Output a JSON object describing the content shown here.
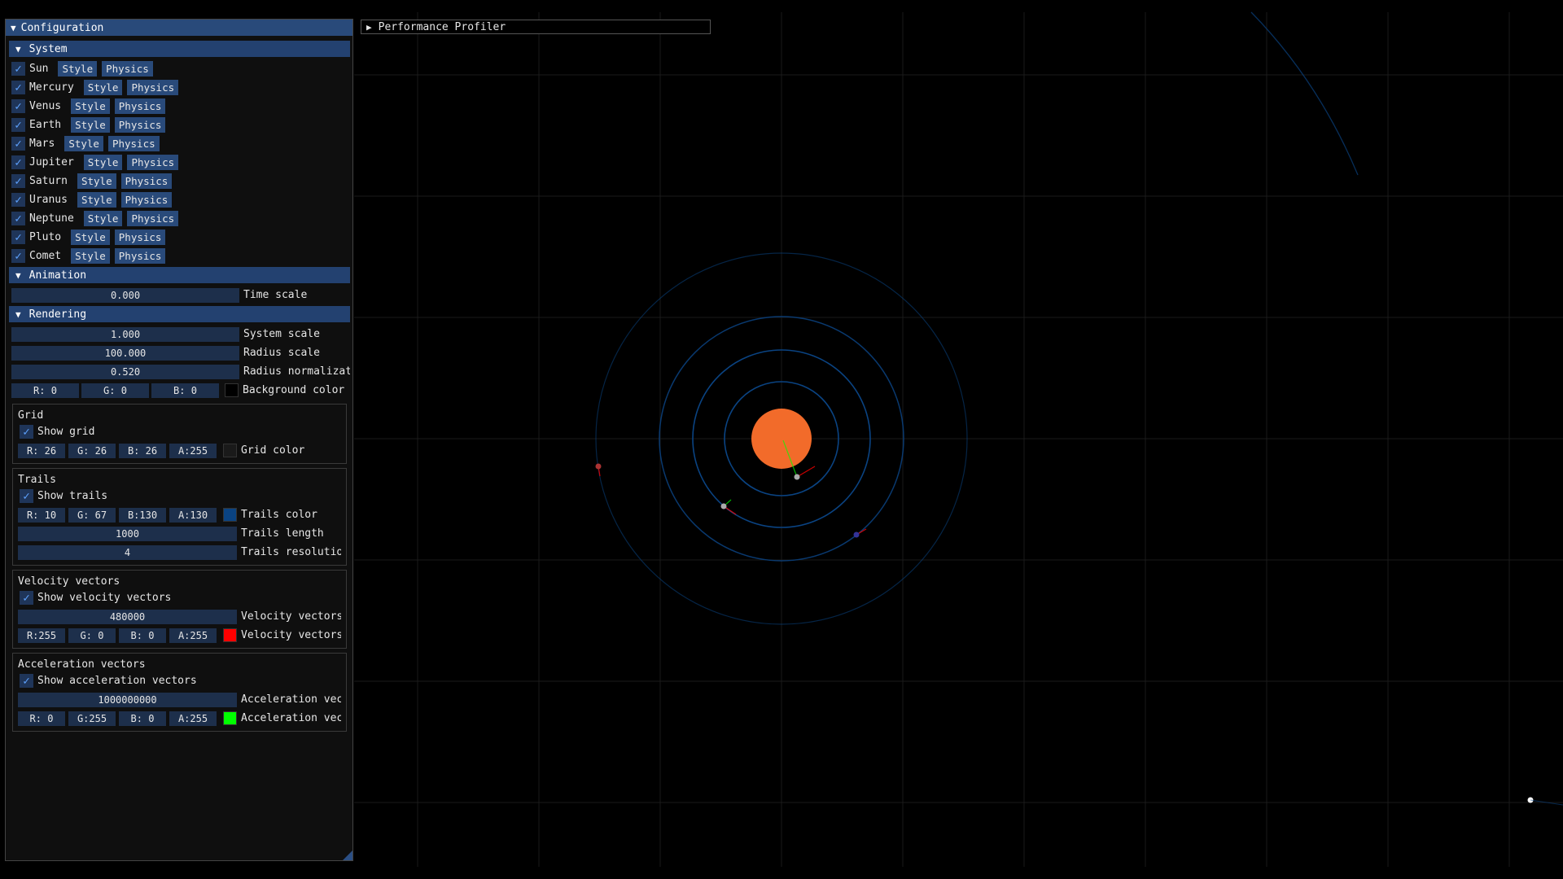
{
  "colors": {
    "accent": "#294a7a",
    "sun": "#f26b2a",
    "trail": "#0a4382",
    "velocity": "#ff0000",
    "acceleration": "#00ff00",
    "grid": "#1a1a1a"
  },
  "config": {
    "title": "Configuration",
    "system": {
      "header": "System",
      "bodies": [
        {
          "name": "Sun",
          "style": "Style",
          "physics": "Physics"
        },
        {
          "name": "Mercury",
          "style": "Style",
          "physics": "Physics"
        },
        {
          "name": "Venus",
          "style": "Style",
          "physics": "Physics"
        },
        {
          "name": "Earth",
          "style": "Style",
          "physics": "Physics"
        },
        {
          "name": "Mars",
          "style": "Style",
          "physics": "Physics"
        },
        {
          "name": "Jupiter",
          "style": "Style",
          "physics": "Physics"
        },
        {
          "name": "Saturn",
          "style": "Style",
          "physics": "Physics"
        },
        {
          "name": "Uranus",
          "style": "Style",
          "physics": "Physics"
        },
        {
          "name": "Neptune",
          "style": "Style",
          "physics": "Physics"
        },
        {
          "name": "Pluto",
          "style": "Style",
          "physics": "Physics"
        },
        {
          "name": "Comet",
          "style": "Style",
          "physics": "Physics"
        }
      ]
    },
    "animation": {
      "header": "Animation",
      "time_scale_value": "0.000",
      "time_scale_label": "Time scale"
    },
    "rendering": {
      "header": "Rendering",
      "system_scale_value": "1.000",
      "system_scale_label": "System scale",
      "radius_scale_value": "100.000",
      "radius_scale_label": "Radius scale",
      "radius_norm_value": "0.520",
      "radius_norm_label": "Radius normalization",
      "bg": {
        "r": "R:  0",
        "g": "G:  0",
        "b": "B:  0",
        "label": "Background color"
      }
    },
    "grid": {
      "title": "Grid",
      "show": "Show grid",
      "r": "R: 26",
      "g": "G: 26",
      "b": "B: 26",
      "a": "A:255",
      "label": "Grid color"
    },
    "trails": {
      "title": "Trails",
      "show": "Show trails",
      "r": "R: 10",
      "g": "G: 67",
      "b": "B:130",
      "a": "A:130",
      "color_label": "Trails color",
      "length_value": "1000",
      "length_label": "Trails length",
      "res_value": "4",
      "res_label": "Trails resolution"
    },
    "velocity": {
      "title": "Velocity vectors",
      "show": "Show velocity vectors",
      "length_value": "480000",
      "length_label": "Velocity vectors le",
      "r": "R:255",
      "g": "G:  0",
      "b": "B:  0",
      "a": "A:255",
      "color_label": "Velocity vectors co"
    },
    "acceleration": {
      "title": "Acceleration vectors",
      "show": "Show acceleration vectors",
      "length_value": "1000000000",
      "length_label": "Acceleration vector",
      "r": "R:  0",
      "g": "G:255",
      "b": "B:  0",
      "a": "A:255",
      "color_label": "Acceleration vector"
    }
  },
  "profiler": {
    "title": "Performance Profiler"
  }
}
